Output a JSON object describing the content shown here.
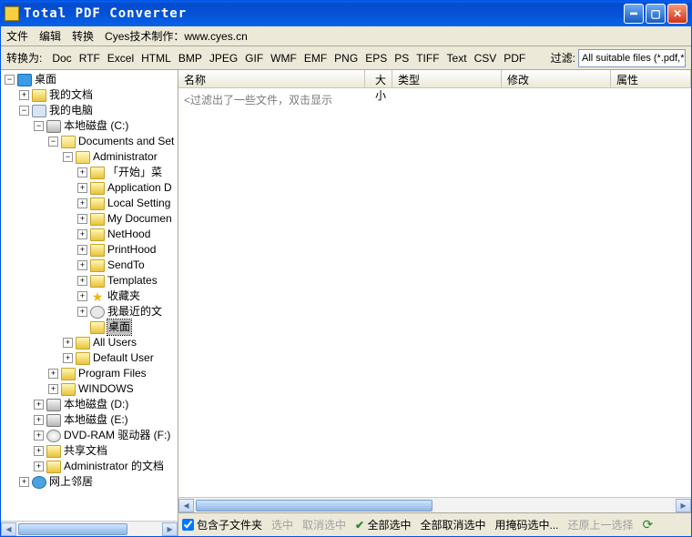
{
  "title": "Total PDF Converter",
  "menu": {
    "file": "文件",
    "edit": "编辑",
    "convert": "转换",
    "help": "Cyes技术制作：www.cyes.cn"
  },
  "toolbar": {
    "label": "转换为:",
    "formats": [
      "Doc",
      "RTF",
      "Excel",
      "HTML",
      "BMP",
      "JPEG",
      "GIF",
      "WMF",
      "EMF",
      "PNG",
      "EPS",
      "PS",
      "TIFF",
      "Text",
      "CSV",
      "PDF"
    ],
    "filter_label": "过滤:",
    "filter_value": "All suitable files (*.pdf,*.p"
  },
  "tree": {
    "desktop": "桌面",
    "mydocs": "我的文档",
    "mypc": "我的电脑",
    "drive_c": "本地磁盘 (C:)",
    "docset": "Documents and Set",
    "admin": "Administrator",
    "startmenu": "「开始」菜",
    "appdata": "Application D",
    "localset": "Local Setting",
    "mydocuments": "My Documen",
    "nethood": "NetHood",
    "printhood": "PrintHood",
    "sendto": "SendTo",
    "templates": "Templates",
    "favorites": "收藏夹",
    "recent": "我最近的文",
    "selected_folder": "桌面",
    "allusers": "All Users",
    "defaultuser": "Default User",
    "progfiles": "Program Files",
    "windows": "WINDOWS",
    "drive_d": "本地磁盘 (D:)",
    "drive_e": "本地磁盘 (E:)",
    "dvd": "DVD-RAM 驱动器 (F:)",
    "shared": "共享文档",
    "admindocs": "Administrator 的文档",
    "network": "网上邻居"
  },
  "list": {
    "col_name": "名称",
    "col_size": "大小",
    "col_type": "类型",
    "col_modified": "修改",
    "col_attr": "属性",
    "empty_msg": "<过滤出了一些文件，双击显示"
  },
  "status": {
    "include_sub": "包含子文件夹",
    "check": "选中",
    "uncheck": "取消选中",
    "checkall": "全部选中",
    "uncheckall": "全部取消选中",
    "usemask": "用掩码选中...",
    "undo": "还原上一选择"
  }
}
